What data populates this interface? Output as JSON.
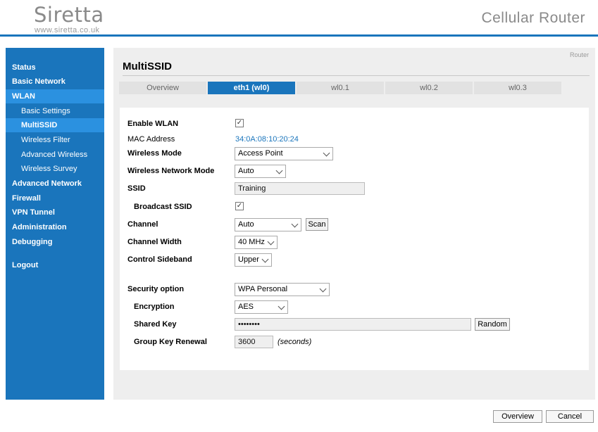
{
  "header": {
    "logo": "Siretta",
    "logo_url": "www.siretta.co.uk",
    "title": "Cellular Router"
  },
  "sidebar": {
    "items": [
      {
        "label": "Status"
      },
      {
        "label": "Basic Network"
      },
      {
        "label": "WLAN"
      },
      {
        "label": "Basic Settings"
      },
      {
        "label": "MultiSSID"
      },
      {
        "label": "Wireless Filter"
      },
      {
        "label": "Advanced Wireless"
      },
      {
        "label": "Wireless Survey"
      },
      {
        "label": "Advanced Network"
      },
      {
        "label": "Firewall"
      },
      {
        "label": "VPN Tunnel"
      },
      {
        "label": "Administration"
      },
      {
        "label": "Debugging"
      },
      {
        "label": "Logout"
      }
    ]
  },
  "main": {
    "breadcrumb": "Router",
    "title": "MultiSSID",
    "tabs": [
      {
        "label": "Overview"
      },
      {
        "label": "eth1 (wl0)"
      },
      {
        "label": "wl0.1"
      },
      {
        "label": "wl0.2"
      },
      {
        "label": "wl0.3"
      }
    ],
    "active_tab": "eth1 (wl0)"
  },
  "form": {
    "enable_wlan": {
      "label": "Enable WLAN",
      "checked": true,
      "mark": "✓"
    },
    "mac_address": {
      "label": "MAC Address",
      "value": "34:0A:08:10:20:24"
    },
    "wireless_mode": {
      "label": "Wireless Mode",
      "value": "Access Point"
    },
    "network_mode": {
      "label": "Wireless Network Mode",
      "value": "Auto"
    },
    "ssid": {
      "label": "SSID",
      "value": "Training"
    },
    "broadcast_ssid": {
      "label": "Broadcast SSID",
      "checked": true,
      "mark": "✓"
    },
    "channel": {
      "label": "Channel",
      "value": "Auto",
      "scan_label": "Scan"
    },
    "channel_width": {
      "label": "Channel Width",
      "value": "40 MHz"
    },
    "control_sideband": {
      "label": "Control Sideband",
      "value": "Upper"
    },
    "security_option": {
      "label": "Security option",
      "value": "WPA Personal"
    },
    "encryption": {
      "label": "Encryption",
      "value": "AES"
    },
    "shared_key": {
      "label": "Shared Key",
      "value": "••••••••",
      "random_label": "Random"
    },
    "group_key_renewal": {
      "label": "Group Key Renewal",
      "value": "3600",
      "unit": "(seconds)"
    }
  },
  "footer": {
    "overview_label": "Overview",
    "cancel_label": "Cancel"
  },
  "colors": {
    "accent": "#1a75bc",
    "accent_active": "#2b91e0"
  }
}
